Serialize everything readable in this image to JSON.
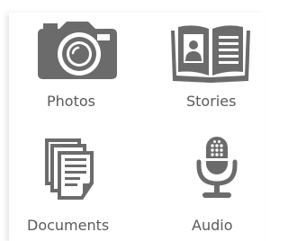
{
  "menu": {
    "items": [
      {
        "label": "Photos",
        "icon": "camera-icon"
      },
      {
        "label": "Stories",
        "icon": "open-book-icon"
      },
      {
        "label": "Documents",
        "icon": "documents-icon"
      },
      {
        "label": "Audio",
        "icon": "microphone-icon"
      }
    ]
  },
  "colors": {
    "icon": "#6b6b6b",
    "label": "#5a5a5a",
    "background": "#ffffff"
  }
}
